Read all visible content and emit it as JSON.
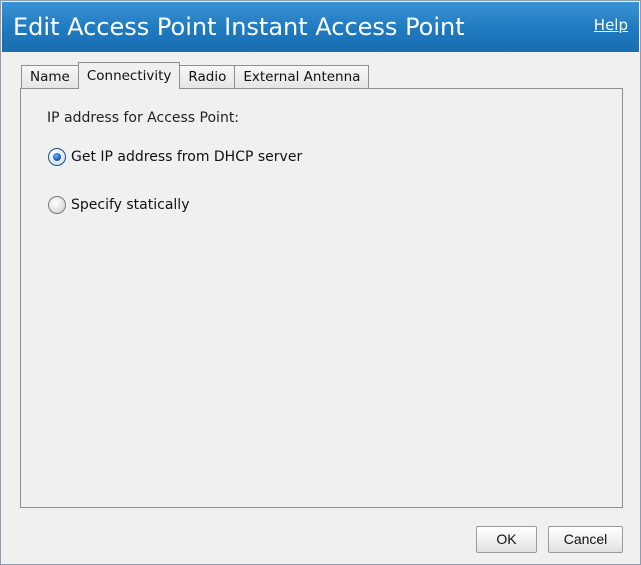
{
  "window": {
    "title": "Edit Access Point Instant Access Point",
    "help_label": "Help"
  },
  "tabs": [
    {
      "label": "Name",
      "active": false
    },
    {
      "label": "Connectivity",
      "active": true
    },
    {
      "label": "Radio",
      "active": false
    },
    {
      "label": "External Antenna",
      "active": false
    }
  ],
  "connectivity": {
    "ip_label": "IP address for Access Point:",
    "options": [
      {
        "label": "Get IP address from DHCP server",
        "checked": true
      },
      {
        "label": "Specify statically",
        "checked": false
      }
    ]
  },
  "buttons": {
    "ok_label": "OK",
    "cancel_label": "Cancel"
  },
  "colors": {
    "titlebar": "#1f79bf",
    "radio_selected": "#1d62c2"
  }
}
